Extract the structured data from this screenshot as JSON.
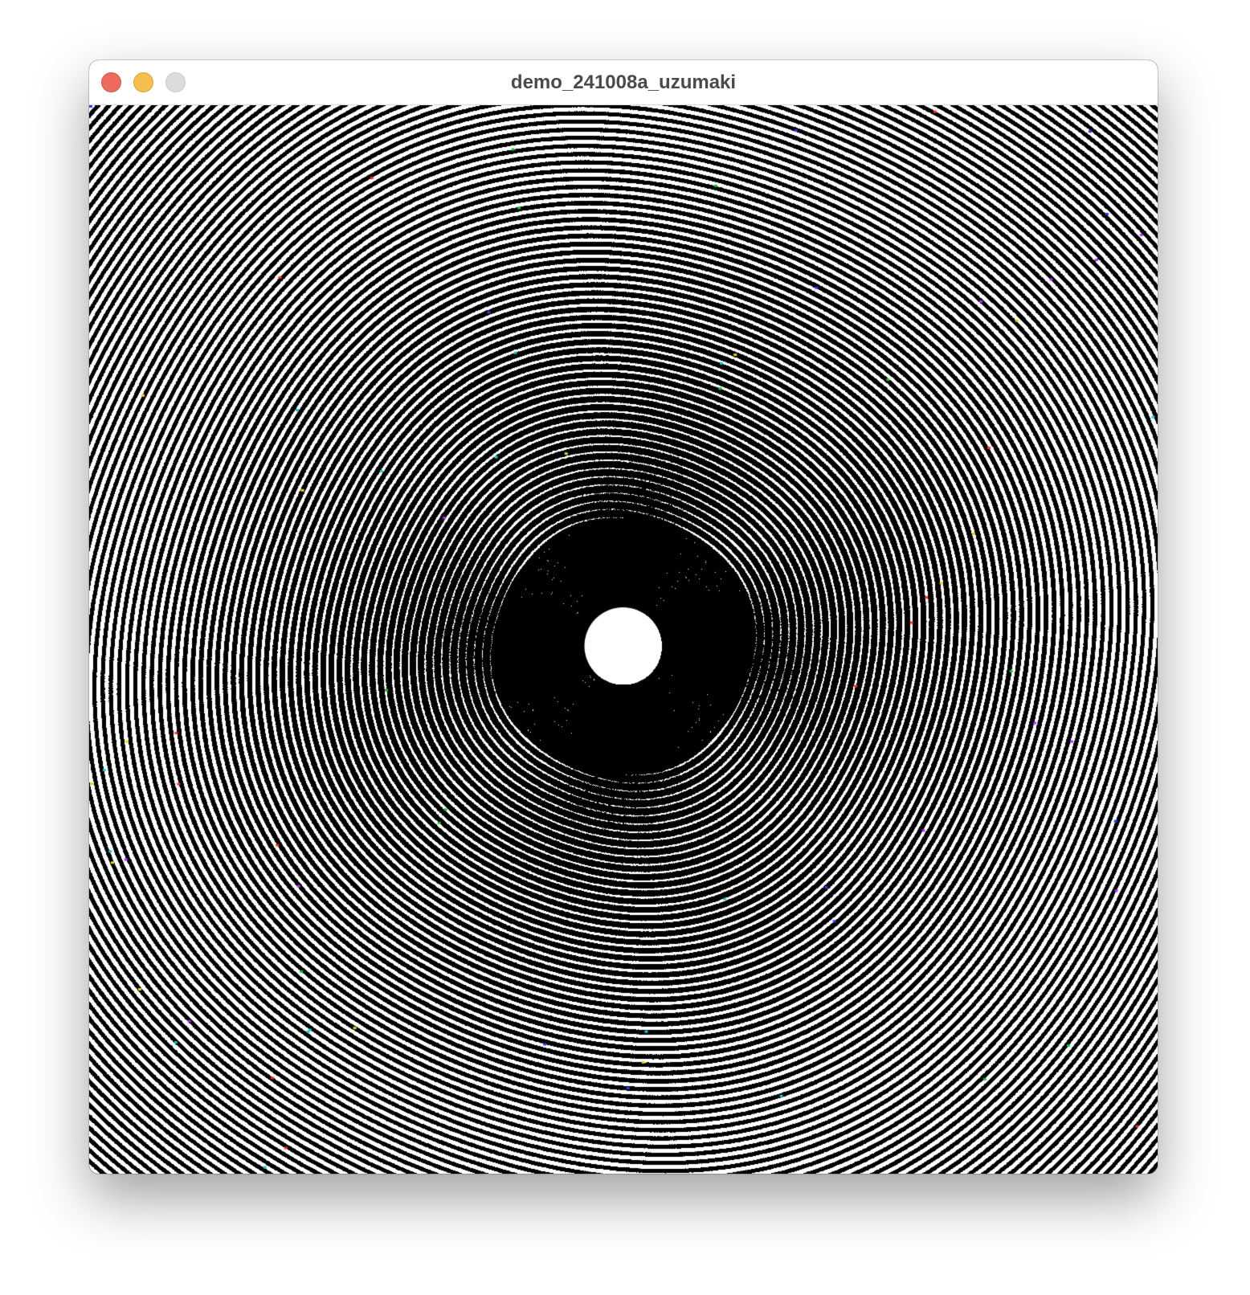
{
  "window": {
    "title": "demo_241008a_uzumaki",
    "buttons": {
      "close": "close-icon",
      "minimize": "minimize-icon",
      "zoom": "zoom-icon"
    },
    "colors": {
      "close": "#ed6a5e",
      "minimize": "#f5bf4f",
      "zoom": "#dcdcdc"
    }
  },
  "canvas": {
    "background": "#000000",
    "foreground": "#ffffff",
    "content": "spiral moiré pattern with solid central disc"
  }
}
